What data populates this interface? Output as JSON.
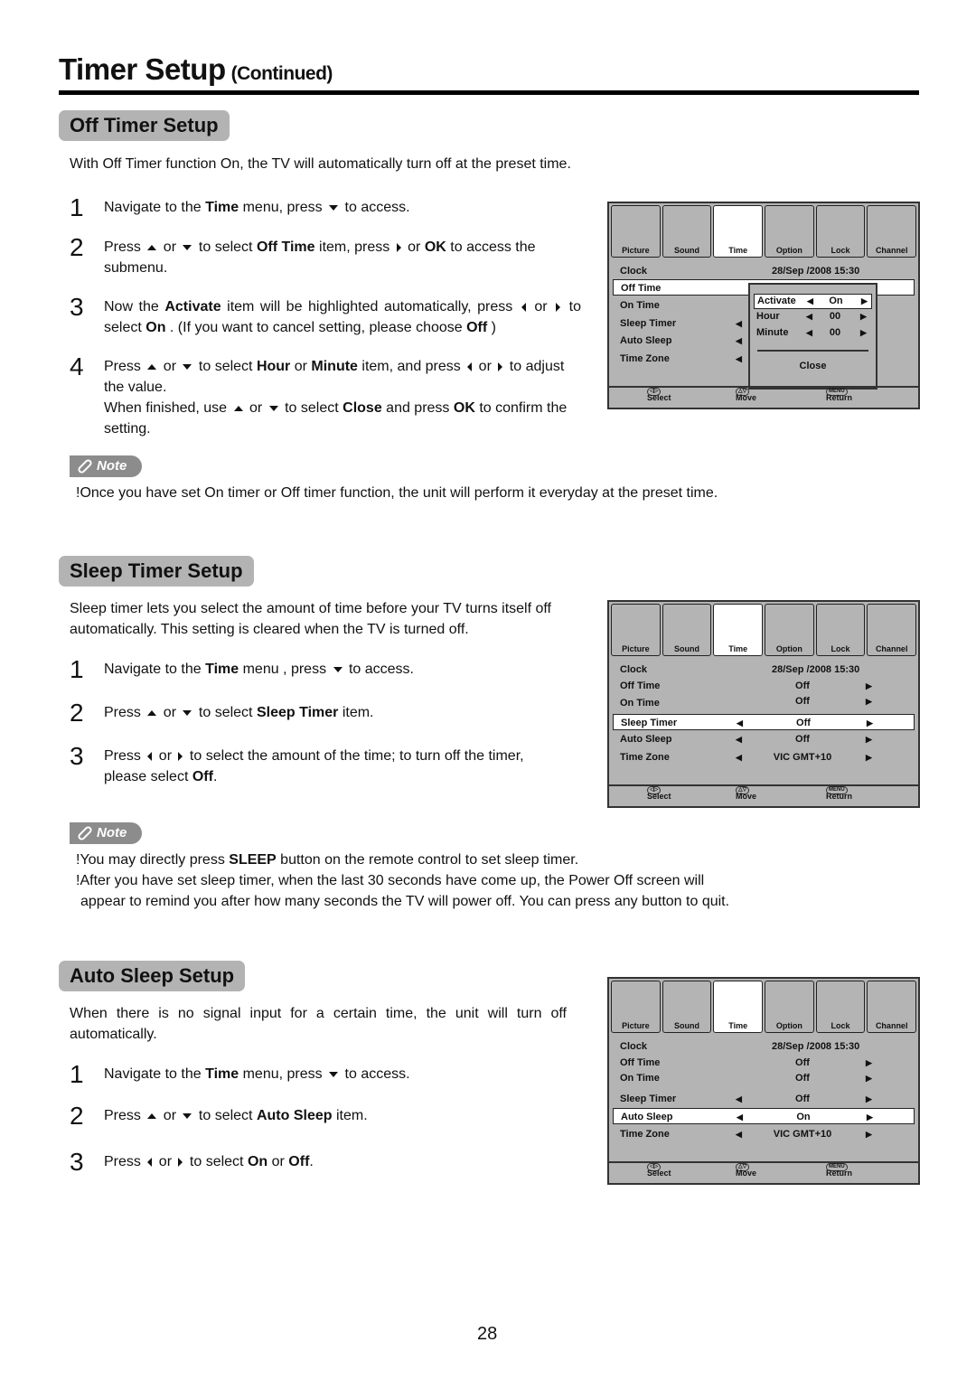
{
  "page": {
    "title": "Timer Setup",
    "title_suffix": "(Continued)",
    "page_number": "28"
  },
  "off_timer": {
    "heading": "Off Timer Setup",
    "intro": "With Off Timer function On, the TV will automatically turn off at the preset time.",
    "steps": [
      {
        "num": "1",
        "parts": [
          "Navigate to the ",
          "Time",
          " menu,  press ",
          "down",
          " to access."
        ]
      },
      {
        "num": "2"
      },
      {
        "num": "3"
      },
      {
        "num": "4"
      }
    ],
    "step2": {
      "a": "Press ",
      "b": " or ",
      "c": "  to select ",
      "d": "Off  Time",
      "e": " item, press ",
      "f": " or ",
      "g": "OK",
      "h": " to access the submenu."
    },
    "step3": {
      "a": "Now the ",
      "b": "Activate",
      "c": " item will be highlighted automatically, press ",
      "d": " or ",
      "e": " to select ",
      "f": "On",
      "g": " . (If you want to cancel setting, please choose ",
      "h": "Off",
      "i": " )"
    },
    "step4": {
      "a": "Press ",
      "b": " or ",
      "c": "  to select ",
      "d": "Hour",
      "e": " or ",
      "f": "Minute",
      "g": " item, and press ",
      "h": " or ",
      "i": " to adjust the value.",
      "j": "When finished, use ",
      "k": " or ",
      "l": "  to select ",
      "m": "Close",
      "n": " and press ",
      "o": "OK",
      "p": " to confirm the setting."
    },
    "note_label": "Note",
    "notes": [
      "!Once you have set On timer or Off timer function, the unit will perform it everyday at the preset time."
    ]
  },
  "sleep_timer": {
    "heading": "Sleep Timer Setup",
    "intro": "Sleep timer lets you select the amount of time before your TV turns itself off automatically. This setting is cleared when the TV is turned off.",
    "step1": {
      "a": "Navigate to the ",
      "b": "Time",
      "c": " menu , press ",
      "d": " to access."
    },
    "step2": {
      "a": "Press ",
      "b": " or ",
      "c": "  to select ",
      "d": "Sleep Timer",
      "e": " item."
    },
    "step3": {
      "a": "Press ",
      "b": " or ",
      "c": " to select the amount of the time; to turn off the timer, please select ",
      "d": "Off",
      "e": "."
    },
    "note_label": "Note",
    "note1": {
      "a": "!You may directly press ",
      "b": "SLEEP",
      "c": " button on the remote control to set sleep timer."
    },
    "note2": "!After you have set sleep timer, when the last 30 seconds have come up, the Power Off screen will",
    "note2_cont": "appear to remind you after how many seconds the TV will power off. You can press any button to quit."
  },
  "auto_sleep": {
    "heading": "Auto Sleep Setup",
    "intro": "When there is no signal input for a certain time, the unit will turn off automatically.",
    "step1": {
      "a": "Navigate to the ",
      "b": "Time",
      "c": " menu,  press ",
      "d": " to access."
    },
    "step2": {
      "a": "Press ",
      "b": " or ",
      "c": "  to select ",
      "d": "Auto Sleep",
      "e": " item."
    },
    "step3": {
      "a": "Press ",
      "b": " or ",
      "c": " to select ",
      "d": "On",
      "e": " or ",
      "f": "Off",
      "g": "."
    }
  },
  "step_numbers": [
    "1",
    "2",
    "3",
    "4"
  ],
  "tv_menu": {
    "tabs": [
      "Picture",
      "Sound",
      "Time",
      "Option",
      "Lock",
      "Channel"
    ],
    "active_tab": "Time",
    "clock_label": "Clock",
    "clock_value": "28/Sep  /2008 15:30",
    "items": [
      "Off Time",
      "On Time",
      "Sleep Timer",
      "Auto Sleep",
      "Time Zone"
    ],
    "footer": {
      "select": "Select",
      "move": "Move",
      "menu_key": "MENU",
      "return": "Return"
    },
    "menu1": {
      "selected": "Off Time",
      "popup": {
        "rows": [
          {
            "label": "Activate",
            "value": "On"
          },
          {
            "label": "Hour",
            "value": "00"
          },
          {
            "label": "Minute",
            "value": "00"
          }
        ],
        "close": "Close"
      }
    },
    "menu2": {
      "selected": "Sleep Timer",
      "values": [
        "Off",
        "Off",
        "Off",
        "Off",
        "VIC GMT+10"
      ]
    },
    "menu3": {
      "selected": "Auto Sleep",
      "values": [
        "Off",
        "Off",
        "Off",
        "On",
        "VIC GMT+10"
      ]
    }
  }
}
